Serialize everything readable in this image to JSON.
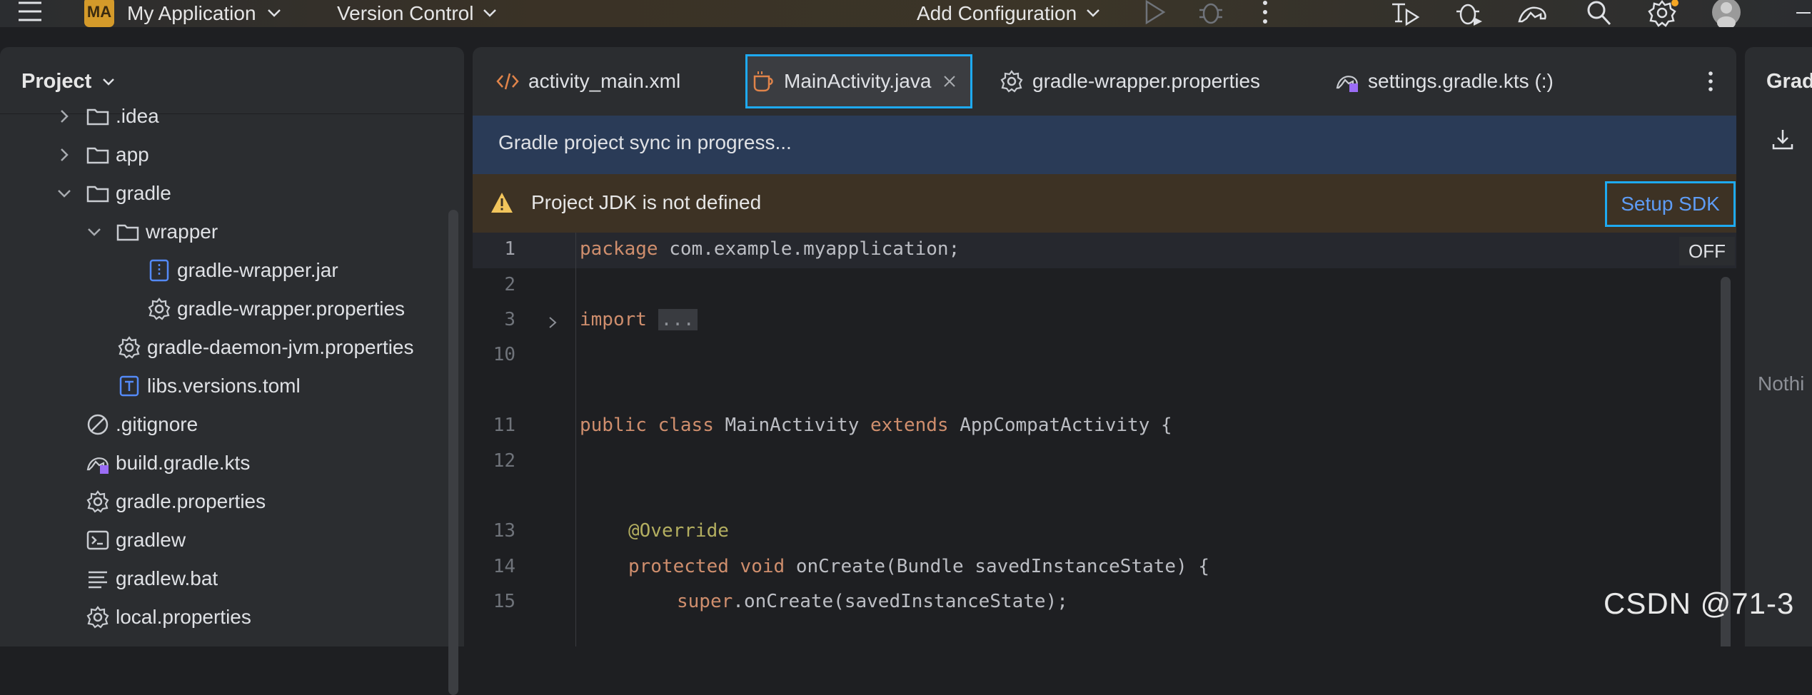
{
  "titlebar": {
    "menu_icon": "hamburger-icon",
    "project_badge": "MA",
    "project_name": "My Application",
    "vcs_label": "Version Control",
    "run_config": "Add Configuration",
    "icons": [
      "run-icon",
      "debug-icon",
      "more-vert-icon",
      "build-run-icon",
      "profiler-icon",
      "gradle-sync-icon",
      "search-icon",
      "settings-icon",
      "avatar"
    ],
    "settings_badge_color": "#f5a623"
  },
  "project_panel": {
    "title": "Project",
    "tree": [
      {
        "label": ".idea",
        "icon": "folder-icon",
        "expanded": false
      },
      {
        "label": "app",
        "icon": "folder-icon",
        "expanded": false
      },
      {
        "label": "gradle",
        "icon": "folder-icon",
        "expanded": true
      },
      {
        "label": "wrapper",
        "icon": "folder-icon",
        "expanded": true
      },
      {
        "label": "gradle-wrapper.jar",
        "icon": "jar-icon"
      },
      {
        "label": "gradle-wrapper.properties",
        "icon": "properties-icon"
      },
      {
        "label": "gradle-daemon-jvm.properties",
        "icon": "properties-icon"
      },
      {
        "label": "libs.versions.toml",
        "icon": "toml-icon"
      },
      {
        "label": ".gitignore",
        "icon": "ignore-icon"
      },
      {
        "label": "build.gradle.kts",
        "icon": "gradle-kts-icon"
      },
      {
        "label": "gradle.properties",
        "icon": "properties-icon"
      },
      {
        "label": "gradlew",
        "icon": "terminal-icon"
      },
      {
        "label": "gradlew.bat",
        "icon": "text-file-icon"
      },
      {
        "label": "local.properties",
        "icon": "properties-icon"
      }
    ]
  },
  "editor": {
    "tabs": [
      {
        "label": "activity_main.xml",
        "icon": "xml-icon"
      },
      {
        "label": "MainActivity.java",
        "icon": "java-icon",
        "active": true
      },
      {
        "label": "gradle-wrapper.properties",
        "icon": "properties-icon"
      },
      {
        "label": "settings.gradle.kts (:)",
        "icon": "gradle-kts-icon"
      }
    ],
    "sync_banner": "Gradle project sync in progress...",
    "jdk_banner": {
      "message": "Project JDK is not defined",
      "action": "Setup SDK",
      "icon": "warning-icon"
    },
    "off_badge": "OFF",
    "code_lines": [
      {
        "num": "1",
        "text": "package com.example.myapplication;"
      },
      {
        "num": "2",
        "text": ""
      },
      {
        "num": "3",
        "text": "import ..."
      },
      {
        "num": "10",
        "text": ""
      },
      {
        "num": "11",
        "text": "public class MainActivity extends AppCompatActivity {"
      },
      {
        "num": "12",
        "text": ""
      },
      {
        "num": "13",
        "text": "@Override"
      },
      {
        "num": "14",
        "text": "protected void onCreate(Bundle savedInstanceState) {"
      },
      {
        "num": "15",
        "text": "super.onCreate(savedInstanceState);"
      }
    ]
  },
  "gradle_panel": {
    "title": "Grad",
    "empty_text": "Nothi"
  },
  "watermark": "CSDN @71-3"
}
